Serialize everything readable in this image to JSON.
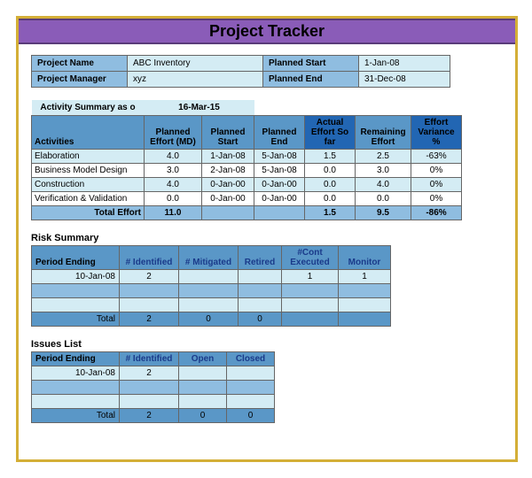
{
  "title": "Project Tracker",
  "project": {
    "nameLabel": "Project Name",
    "nameValue": "ABC Inventory",
    "managerLabel": "Project Manager",
    "managerValue": "xyz",
    "plannedStartLabel": "Planned Start",
    "plannedStartValue": "1-Jan-08",
    "plannedEndLabel": "Planned End",
    "plannedEndValue": "31-Dec-08"
  },
  "activitySummary": {
    "sectionLabel": "Activity Summary as o",
    "asOf": "16-Mar-15",
    "headers": {
      "activities": "Activities",
      "plannedEffort": "Planned Effort (MD)",
      "plannedStart": "Planned Start",
      "plannedEnd": "Planned End",
      "actualEffort": "Actual Effort So far",
      "remaining": "Remaining Effort",
      "variance": "Effort Variance %"
    },
    "rows": [
      {
        "name": "Elaboration",
        "plannedEffort": "4.0",
        "plannedStart": "1-Jan-08",
        "plannedEnd": "5-Jan-08",
        "actual": "1.5",
        "remaining": "2.5",
        "variance": "-63%"
      },
      {
        "name": "Business Model Design",
        "plannedEffort": "3.0",
        "plannedStart": "2-Jan-08",
        "plannedEnd": "5-Jan-08",
        "actual": "0.0",
        "remaining": "3.0",
        "variance": "0%"
      },
      {
        "name": "Construction",
        "plannedEffort": "4.0",
        "plannedStart": "0-Jan-00",
        "plannedEnd": "0-Jan-00",
        "actual": "0.0",
        "remaining": "4.0",
        "variance": "0%"
      },
      {
        "name": "Verification & Validation",
        "plannedEffort": "0.0",
        "plannedStart": "0-Jan-00",
        "plannedEnd": "0-Jan-00",
        "actual": "0.0",
        "remaining": "0.0",
        "variance": "0%"
      }
    ],
    "total": {
      "label": "Total Effort",
      "plannedEffort": "11.0",
      "plannedStart": "",
      "plannedEnd": "",
      "actual": "1.5",
      "remaining": "9.5",
      "variance": "-86%"
    }
  },
  "riskSummary": {
    "sectionLabel": "Risk Summary",
    "headers": {
      "period": "Period Ending",
      "identified": "# Identified",
      "mitigated": "# Mitigated",
      "retired": "Retired",
      "contExec": "#Cont Executed",
      "monitor": "Monitor"
    },
    "rows": [
      {
        "period": "10-Jan-08",
        "identified": "2",
        "mitigated": "",
        "retired": "",
        "contExec": "1",
        "monitor": "1"
      }
    ],
    "total": {
      "label": "Total",
      "identified": "2",
      "mitigated": "0",
      "retired": "0",
      "contExec": "",
      "monitor": ""
    }
  },
  "issuesList": {
    "sectionLabel": "Issues List",
    "headers": {
      "period": "Period Ending",
      "identified": "# Identified",
      "open": "Open",
      "closed": "Closed"
    },
    "rows": [
      {
        "period": "10-Jan-08",
        "identified": "2",
        "open": "",
        "closed": ""
      }
    ],
    "total": {
      "label": "Total",
      "identified": "2",
      "open": "0",
      "closed": "0"
    }
  }
}
